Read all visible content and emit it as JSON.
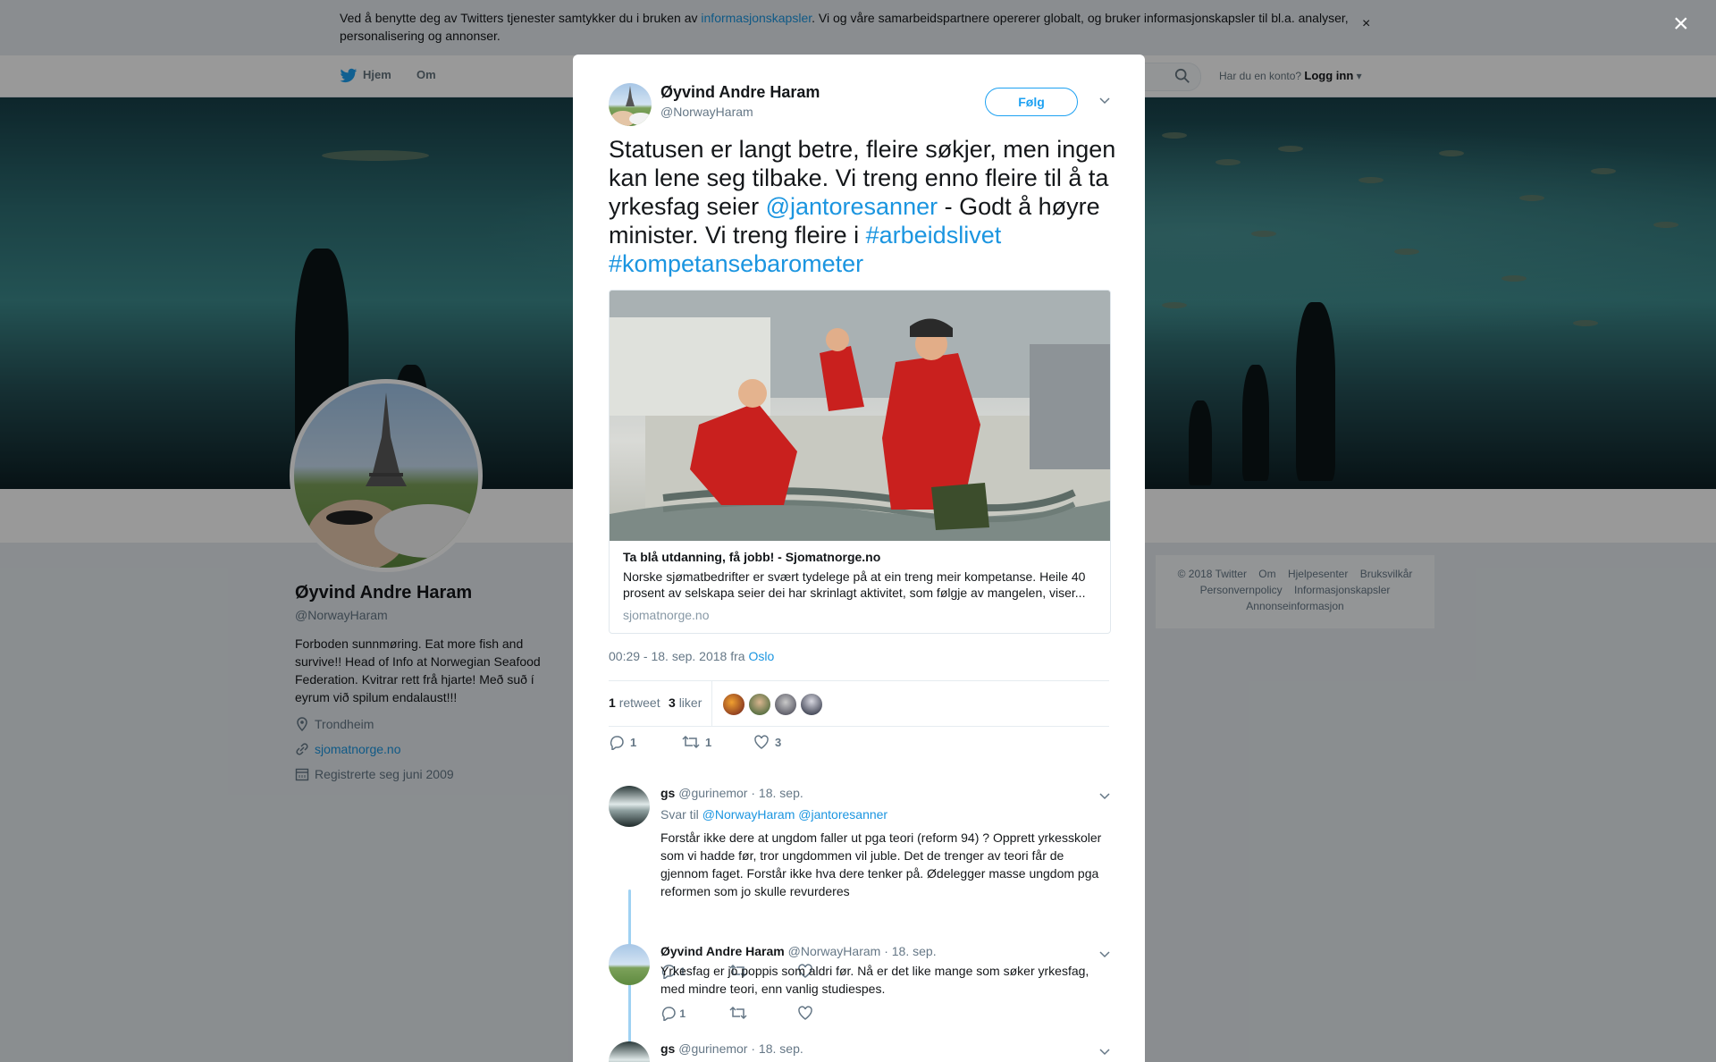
{
  "cookie_bar": {
    "text_before": "Ved å benytte deg av Twitters tjenester samtykker du i bruken av ",
    "link": "informasjonskapsler",
    "text_after": ". Vi og våre samarbeidspartnere opererer globalt, og bruker informasjonskapsler til bl.a. analyser, personalisering og annonser.",
    "close": "×"
  },
  "topnav": {
    "home": "Hjem",
    "about": "Om",
    "account_prompt": "Har du en konto?",
    "login": "Logg inn",
    "login_caret": "▾"
  },
  "overlay_close": "×",
  "profile": {
    "name": "Øyvind Andre Haram",
    "handle": "@NorwayHaram",
    "bio": "Forboden sunnmøring. Eat more fish and survive!! Head of Info at Norwegian Seafood Federation. Kvitrar rett frå hjarte! Með suð í eyrum við spilum endalaust!!!",
    "location": "Trondheim",
    "website": "sjomatnorge.no",
    "joined": "Registrerte seg juni 2009"
  },
  "footer": {
    "links": [
      "© 2018 Twitter",
      "Om",
      "Hjelpesenter",
      "Bruksvilkår",
      "Personvernpolicy",
      "Informasjonskapsler",
      "Annonseinformasjon"
    ]
  },
  "tweet": {
    "author_name": "Øyvind Andre Haram",
    "author_handle": "@NorwayHaram",
    "follow_label": "Følg",
    "text_1": "Statusen er langt betre, fleire søkjer, men ingen kan lene seg tilbake. Vi treng enno fleire til å ta yrkesfag seier ",
    "mention": "@jantoresanner",
    "text_2": " - Godt å høyre minister. Vi treng fleire i ",
    "hashtag_1": "#arbeidslivet",
    "hashtag_2": "#kompetansebarometer",
    "card": {
      "title": "Ta blå utdanning, få jobb! - Sjomatnorge.no",
      "description": "Norske sjømatbedrifter er svært tydelege på at ein treng meir kompetanse. Heile 40 prosent av selskapa seier dei har skrinlagt aktivitet, som følgje av mangelen, viser...",
      "domain": "sjomatnorge.no"
    },
    "time": "00:29 - 18. sep. 2018 fra ",
    "place": "Oslo",
    "retweets": "1",
    "retweets_label": "retweet",
    "likes": "3",
    "likes_label": "liker",
    "reply_count": "1",
    "retweet_count": "1",
    "like_count": "3"
  },
  "replies": [
    {
      "name": "gs",
      "handle": "@gurinemor",
      "date": "· 18. sep.",
      "reply_to_label": "Svar til",
      "reply_to_1": "@NorwayHaram",
      "reply_to_2": "@jantoresanner",
      "text": "Forstår ikke dere at ungdom faller ut pga teori (reform 94) ? Opprett yrkesskoler som vi hadde før, tror ungdommen vil juble. Det de trenger av teori får de gjennom faget. Forstår ikke hva dere tenker på. Ødelegger masse ungdom pga reformen som jo skulle revurderes",
      "reply_count": "1"
    },
    {
      "name": "Øyvind Andre Haram",
      "handle": "@NorwayHaram",
      "date": "· 18. sep.",
      "text": "Yrkesfag er jo poppis som aldri før. Nå er det like mange som søker yrkesfag, med mindre teori, enn vanlig studiespes.",
      "reply_count": "1"
    },
    {
      "name": "gs",
      "handle": "@gurinemor",
      "date": "· 18. sep."
    }
  ]
}
